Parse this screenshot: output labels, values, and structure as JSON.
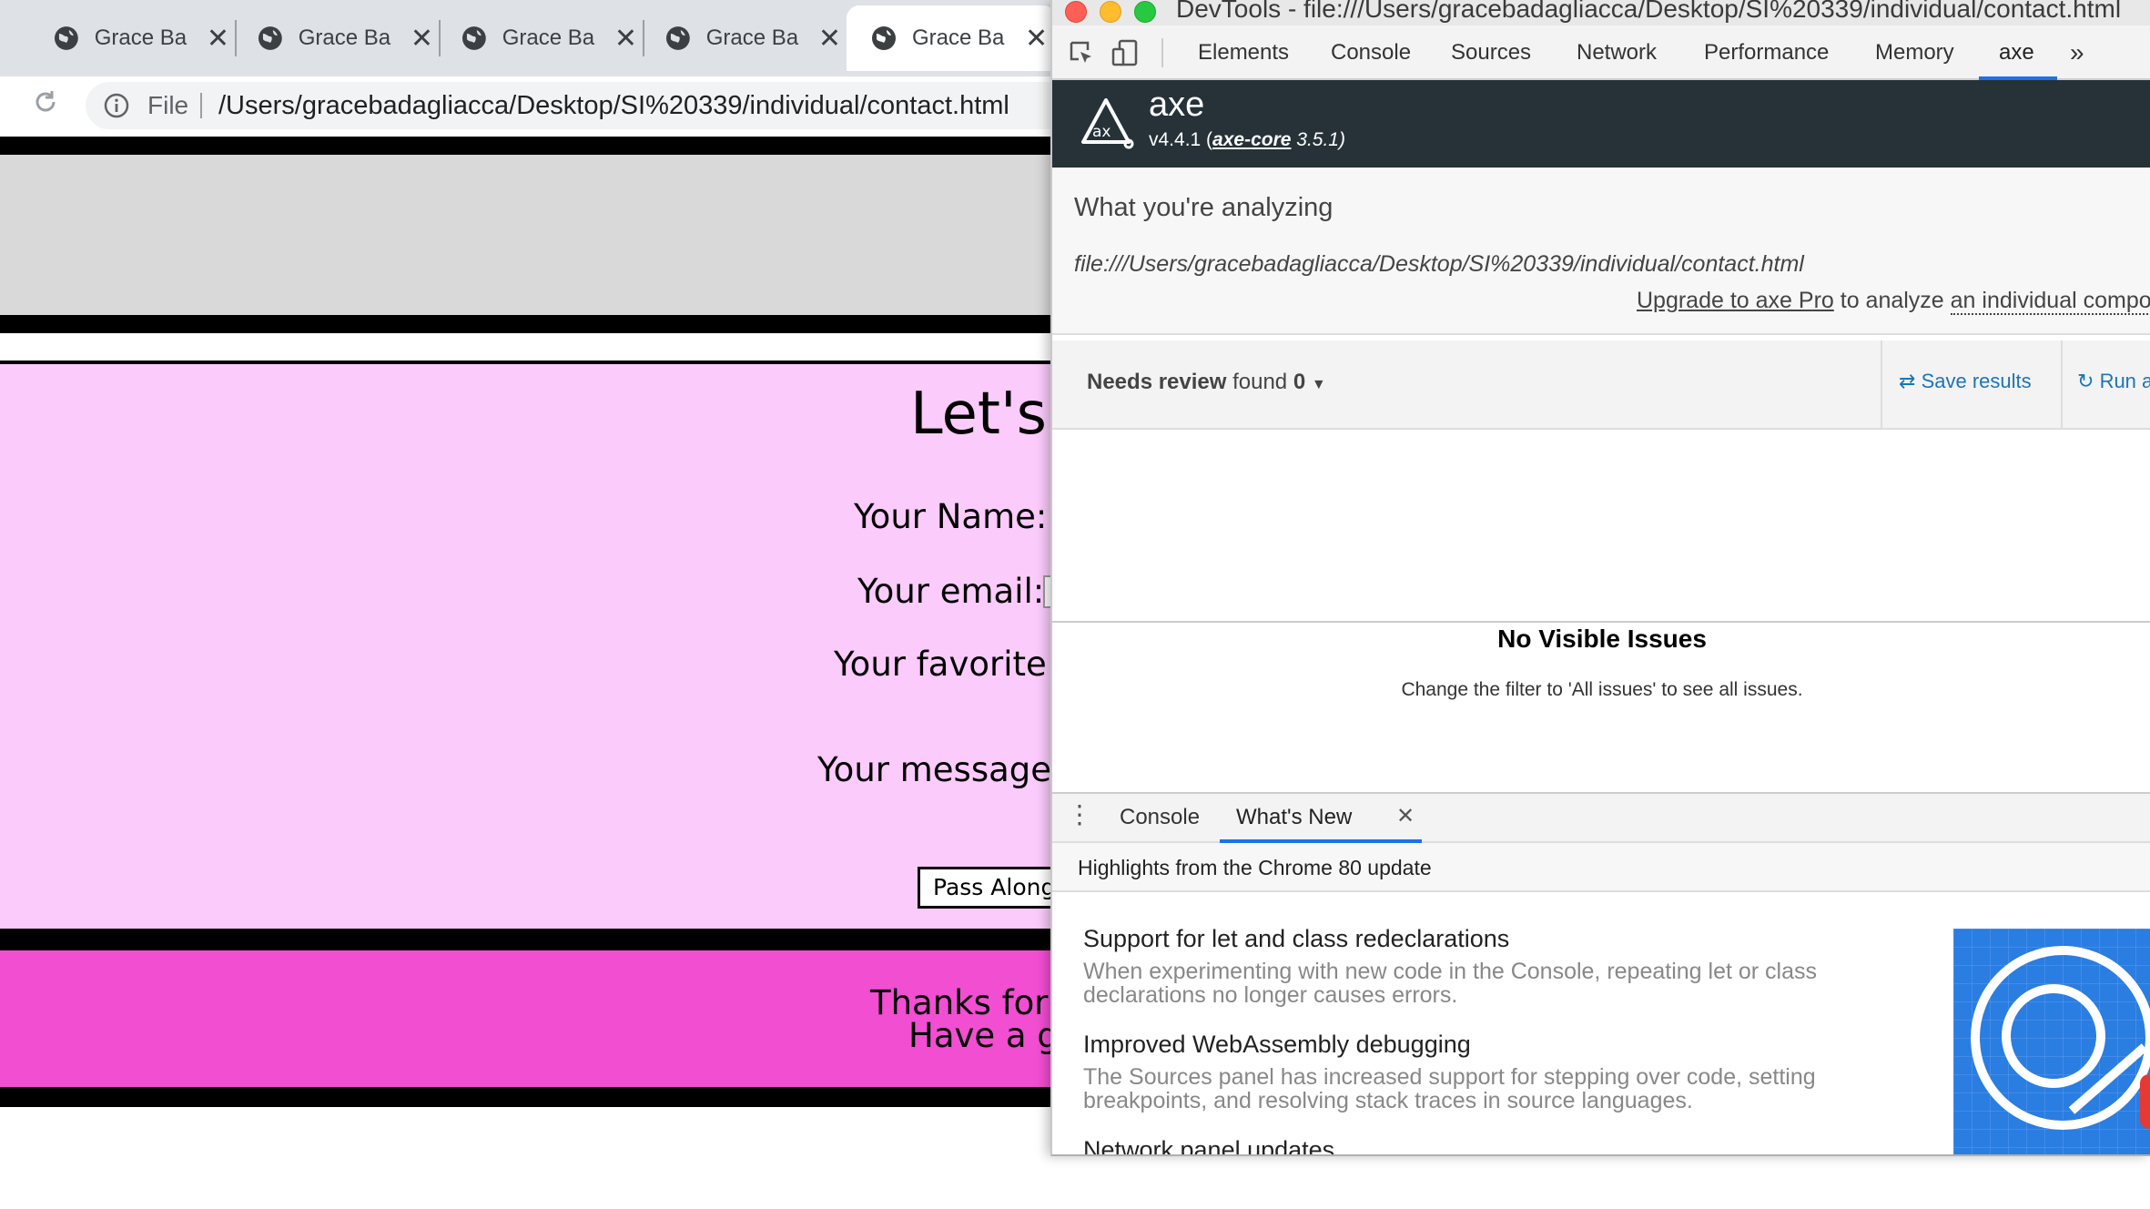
{
  "browser": {
    "tabs": [
      {
        "label": "Grace Ba"
      },
      {
        "label": "Grace Ba"
      },
      {
        "label": "Grace Ba"
      },
      {
        "label": "Grace Ba"
      },
      {
        "label": "Grace Ba"
      }
    ],
    "omnibox": {
      "scheme_label": "File",
      "url": "/Users/gracebadagliacca/Desktop/SI%20339/individual/contact.html"
    }
  },
  "page": {
    "heading": "Let's",
    "form": {
      "name_label": "Your Name:",
      "email_label": "Your email:",
      "favorite_label": "Your favorite",
      "message_label": "Your message",
      "submit_label": "Pass Along"
    },
    "footer": {
      "line1": "Thanks for",
      "line2": "Have a gr"
    },
    "colors": {
      "form_bg": "#fbcbfb",
      "footer_bg": "#f24ed2",
      "header_bg": "#d9d9d9",
      "band": "#000000"
    }
  },
  "devtools": {
    "title": "DevTools - file:///Users/gracebadagliacca/Desktop/SI%20339/individual/contact.html",
    "tabs": [
      "Elements",
      "Console",
      "Sources",
      "Network",
      "Performance",
      "Memory",
      "axe"
    ],
    "more_icon": "chevron-double-right-icon",
    "axe": {
      "name": "axe",
      "version_prefix": "v4.4.1 (",
      "core_link": "axe-core",
      "core_version": " 3.5.1)",
      "analyzing_heading": "What you're analyzing",
      "analyzing_url": "file:///Users/gracebadagliacca/Desktop/SI%20339/individual/contact.html",
      "upgrade_link": "Upgrade to axe Pro",
      "upgrade_text": " to analyze ",
      "upgrade_tail": "an individual compo",
      "filter_label_bold": "Needs review",
      "filter_label_rest": " found ",
      "filter_count": "0",
      "save_label": "Save results",
      "run_label": "Run a",
      "empty_title": "No Visible Issues",
      "empty_text": "Change the filter to 'All issues' to see all issues.",
      "accent": "#1b75bc"
    },
    "drawer": {
      "tabs": [
        "Console",
        "What's New"
      ],
      "highlight": "Highlights from the Chrome 80 update",
      "items": [
        {
          "title": "Support for let and class redeclarations",
          "text1": "When experimenting with new code in the Console, repeating let or class",
          "text2": "declarations no longer causes errors."
        },
        {
          "title": "Improved WebAssembly debugging",
          "text1": "The Sources panel has increased support for stepping over code, setting",
          "text2": "breakpoints, and resolving stack traces in source languages."
        },
        {
          "title": "Network panel updates",
          "text1": "",
          "text2": ""
        }
      ]
    }
  }
}
